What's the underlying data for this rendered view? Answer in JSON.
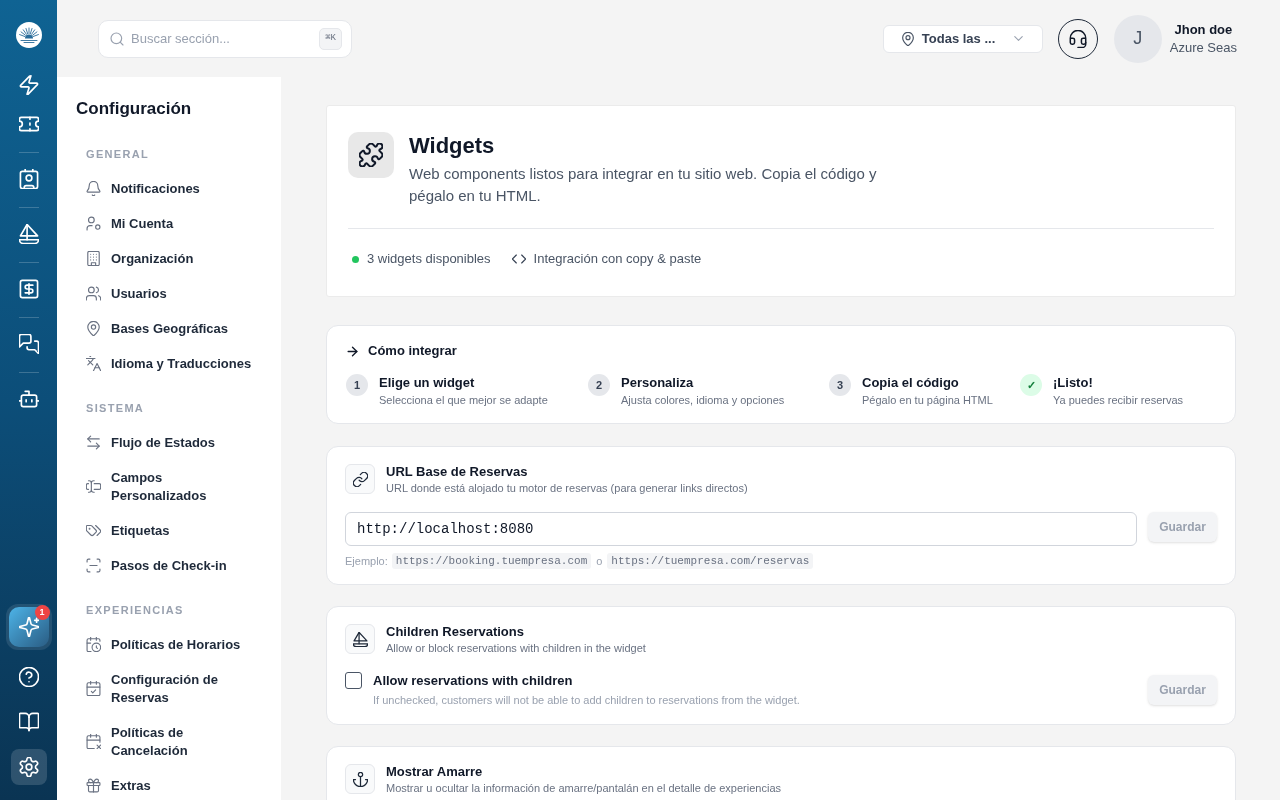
{
  "rail": {
    "items": [
      {
        "selected": false
      },
      {
        "selected": false
      },
      {
        "selected": false
      },
      {
        "selected": false
      },
      {
        "selected": false
      },
      {
        "selected": false
      },
      {
        "selected": false
      }
    ],
    "bottom_items": [
      {
        "kind": "assistant",
        "badge": "1",
        "selected": false
      },
      {
        "kind": "link",
        "selected": false
      },
      {
        "kind": "link",
        "selected": false
      },
      {
        "kind": "link",
        "selected": true
      }
    ]
  },
  "header": {
    "search": {
      "placeholder": "Buscar sección...",
      "shortcut": "⌘K"
    },
    "location": {
      "value": "Todas las ..."
    },
    "user": {
      "initial": "J",
      "name": "Jhon doe",
      "organization": "Azure Seas"
    }
  },
  "sidebar": {
    "title": "Configuración",
    "sections": [
      {
        "label": "GENERAL",
        "items": [
          {
            "label": "Notificaciones",
            "selected": false
          },
          {
            "label": "Mi Cuenta",
            "selected": false
          },
          {
            "label": "Organización",
            "selected": false
          },
          {
            "label": "Usuarios",
            "selected": false
          },
          {
            "label": "Bases Geográficas",
            "selected": false
          },
          {
            "label": "Idioma y Traducciones",
            "selected": false
          }
        ]
      },
      {
        "label": "SISTEMA",
        "items": [
          {
            "label": "Flujo de Estados",
            "selected": false
          },
          {
            "label": "Campos Personalizados",
            "selected": false
          },
          {
            "label": "Etiquetas",
            "selected": false
          },
          {
            "label": "Pasos de Check-in",
            "selected": false
          }
        ]
      },
      {
        "label": "EXPERIENCIAS",
        "items": [
          {
            "label": "Políticas de Horarios",
            "selected": false
          },
          {
            "label": "Configuración de Reservas",
            "selected": false
          },
          {
            "label": "Políticas de Cancelación",
            "selected": false
          },
          {
            "label": "Extras",
            "selected": false
          }
        ]
      }
    ]
  },
  "page": {
    "title": "Widgets",
    "description": "Web components listos para integrar en tu sitio web. Copia el código y pégalo en tu HTML.",
    "stats": [
      {
        "kind": "status",
        "text": "3 widgets disponibles"
      },
      {
        "kind": "code",
        "text": "Integración con copy & paste"
      }
    ]
  },
  "howto": {
    "title": "Cómo integrar",
    "steps": [
      {
        "marker": "1",
        "title": "Elige un widget",
        "subtitle": "Selecciona el que mejor se adapte",
        "done": false
      },
      {
        "marker": "2",
        "title": "Personaliza",
        "subtitle": "Ajusta colores, idioma y opciones",
        "done": false
      },
      {
        "marker": "3",
        "title": "Copia el código",
        "subtitle": "Pégalo en tu página HTML",
        "done": false
      },
      {
        "marker": "✓",
        "title": "¡Listo!",
        "subtitle": "Ya puedes recibir reservas",
        "done": true
      }
    ]
  },
  "settings": [
    {
      "kind": "url_input",
      "title": "URL Base de Reservas",
      "description": "URL donde está alojado tu motor de reservas (para generar links directos)",
      "value": "http://localhost:8080",
      "button": {
        "label": "Guardar",
        "disabled": true
      },
      "hint": {
        "label": "Ejemplo:",
        "examples": [
          "https://booking.tuempresa.com",
          "https://tuempresa.com/reservas"
        ],
        "separator": "o"
      }
    },
    {
      "kind": "checkbox",
      "title": "Children Reservations",
      "description": "Allow or block reservations with children in the widget",
      "option": {
        "label": "Allow reservations with children",
        "help": "If unchecked, customers will not be able to add children to reservations from the widget.",
        "checked": false
      },
      "button": {
        "label": "Guardar",
        "disabled": true
      }
    },
    {
      "kind": "heading",
      "title": "Mostrar Amarre",
      "description": "Mostrar u ocultar la información de amarre/pantalán en el detalle de experiencias"
    }
  ]
}
